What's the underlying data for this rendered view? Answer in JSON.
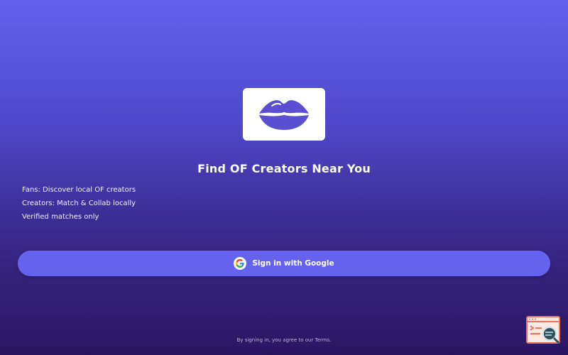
{
  "logo": {
    "icon": "lips-icon",
    "icon_color": "#5a4fd0"
  },
  "title": "Find OF Creators Near You",
  "features": [
    "Fans: Discover local OF creators",
    "Creators: Match & Collab locally",
    "Verified matches only"
  ],
  "signin_button": {
    "label": "Sign in with Google",
    "icon": "google-icon"
  },
  "terms_text": "By signing in, you agree to our Terms.",
  "corner_widget": {
    "icon": "browser-search-icon",
    "accent": "#e8735f"
  },
  "colors": {
    "background_top": "#6262ef",
    "background_bottom": "#2a1660",
    "button": "#6563ee"
  }
}
